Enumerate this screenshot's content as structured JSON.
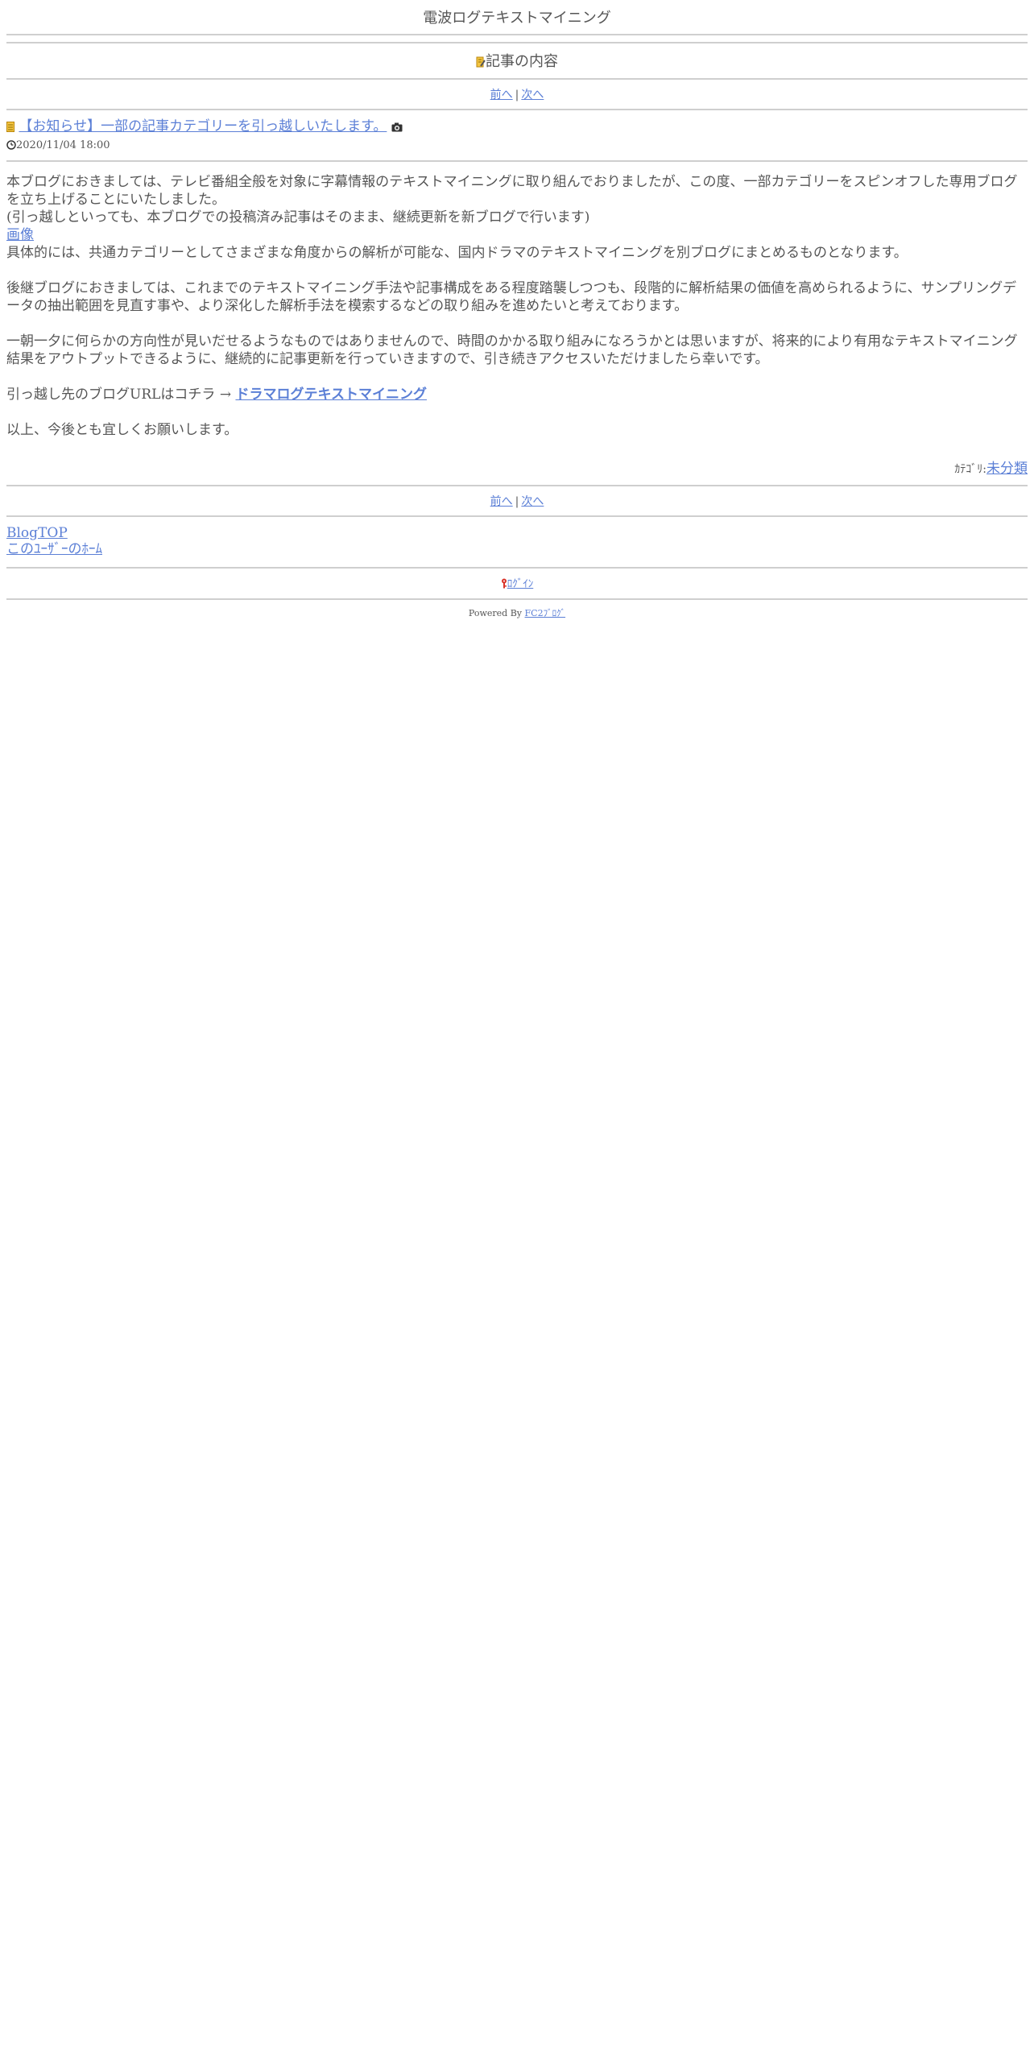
{
  "blog": {
    "title": "電波ログテキストマイニング"
  },
  "section": {
    "title": "記事の内容"
  },
  "nav": {
    "prev": "前へ",
    "sep": "|",
    "next": "次へ"
  },
  "entry": {
    "title": "【お知らせ】一部の記事カテゴリーを引っ越しいたします。",
    "date": "2020/11/04 18:00",
    "p1_line1": "本ブログにおきましては、テレビ番組全般を対象に字幕情報のテキストマイニングに取り組んでおりましたが、この度、一部カテゴリーをスピンオフした専用ブログを立ち上げることにいたしました。",
    "p1_line2": "(引っ越しといっても、本ブログでの投稿済み記事はそのまま、継続更新を新ブログで行います)",
    "image_link": "画像",
    "p1_line3": "具体的には、共通カテゴリーとしてさまざまな角度からの解析が可能な、国内ドラマのテキストマイニングを別ブログにまとめるものとなります。",
    "p2": "後継ブログにおきましては、これまでのテキストマイニング手法や記事構成をある程度踏襲しつつも、段階的に解析結果の価値を高められるように、サンプリングデータの抽出範囲を見直す事や、より深化した解析手法を模索するなどの取り組みを進めたいと考えております。",
    "p3": "一朝一夕に何らかの方向性が見いだせるようなものではありませんので、時間のかかる取り組みになろうかとは思いますが、将来的により有用なテキストマイニング結果をアウトプットできるように、継続的に記事更新を行っていきますので、引き続きアクセスいただけましたら幸いです。",
    "p4_prefix": "引っ越し先のブログURLはコチラ →",
    "p4_link": "ドラマログテキストマイニング",
    "p5": "以上、今後とも宜しくお願いします。",
    "category_label": "ｶﾃｺﾞﾘ:",
    "category_value": "未分類"
  },
  "footer": {
    "blog_top": "BlogTOP",
    "user_home": "このﾕｰｻﾞｰのﾎｰﾑ",
    "login": "ﾛｸﾞｲﾝ",
    "powered_prefix": "Powered By",
    "powered_link": "FC2ﾌﾞﾛｸﾞ"
  },
  "colors": {
    "link": "#5b7fd6",
    "text": "#555555",
    "rule": "#cfcfcf",
    "accent": "#e8a317"
  }
}
